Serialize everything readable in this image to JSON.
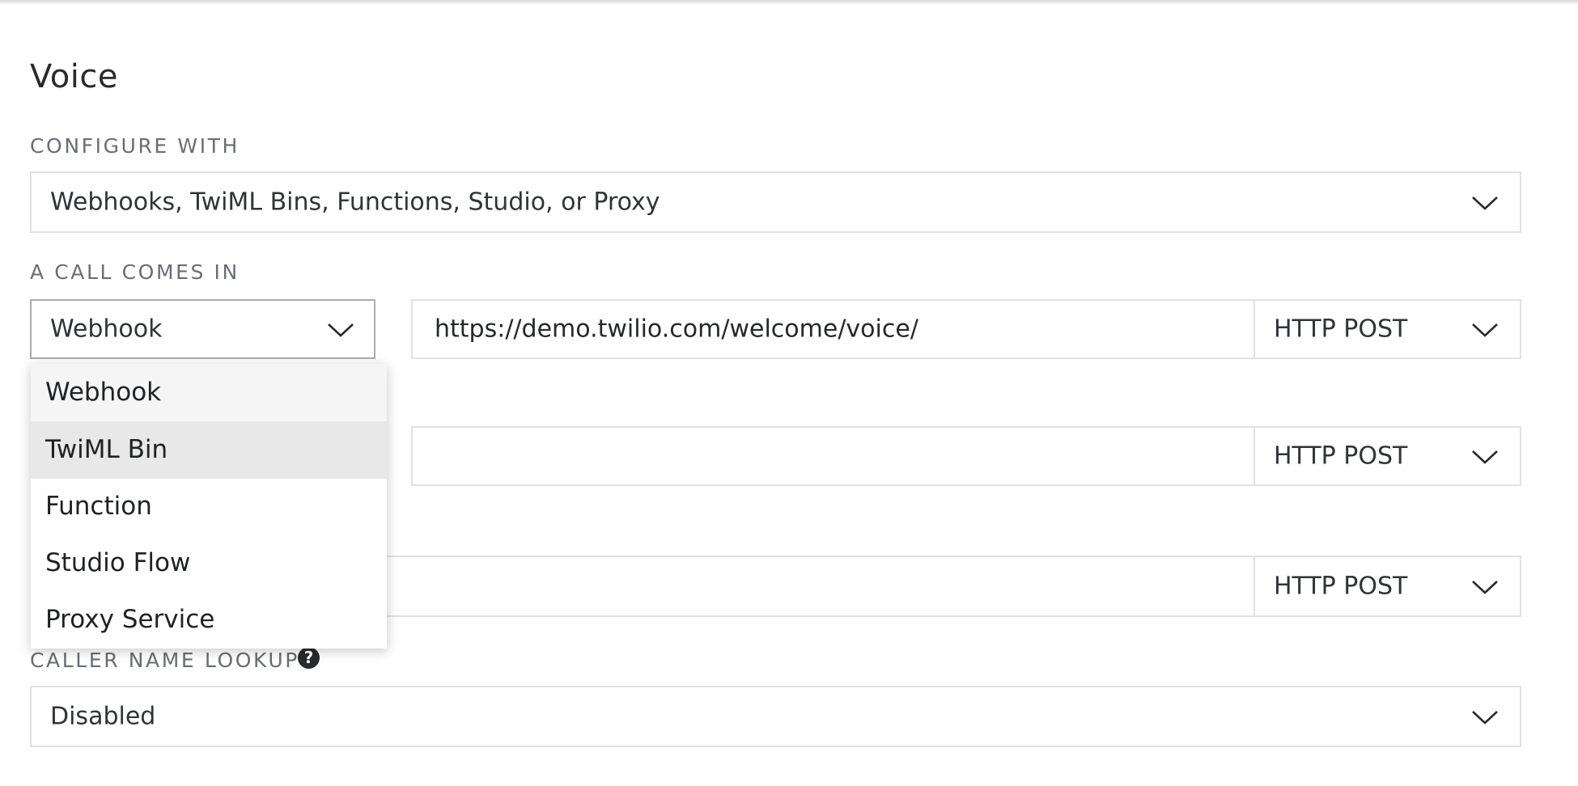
{
  "section": {
    "title": "Voice"
  },
  "configure_with": {
    "label": "CONFIGURE WITH",
    "value": "Webhooks, TwiML Bins, Functions, Studio, or Proxy"
  },
  "call_comes_in": {
    "label": "A CALL COMES IN",
    "type_value": "Webhook",
    "url_value": "https://demo.twilio.com/welcome/voice/",
    "method_value": "HTTP POST"
  },
  "row2": {
    "url_value": "",
    "method_value": "HTTP POST"
  },
  "row3": {
    "url_value": "",
    "method_value": "HTTP POST"
  },
  "type_dropdown": {
    "options": [
      "Webhook",
      "TwiML Bin",
      "Function",
      "Studio Flow",
      "Proxy Service"
    ],
    "selected_index": 0,
    "highlighted_index": 1
  },
  "caller_name_lookup": {
    "label": "CALLER NAME LOOKUP",
    "help_icon_text": "?",
    "value": "Disabled"
  },
  "colors": {
    "border": "#e2e2e2",
    "selected_border": "#a9abad",
    "highlight": "#e8e8e8",
    "selected_bg": "#f5f5f5",
    "label": "#6b6d75",
    "text": "#282a2b"
  },
  "icons": {
    "chevron": "chevron-down-icon",
    "help": "question-circle-icon"
  }
}
